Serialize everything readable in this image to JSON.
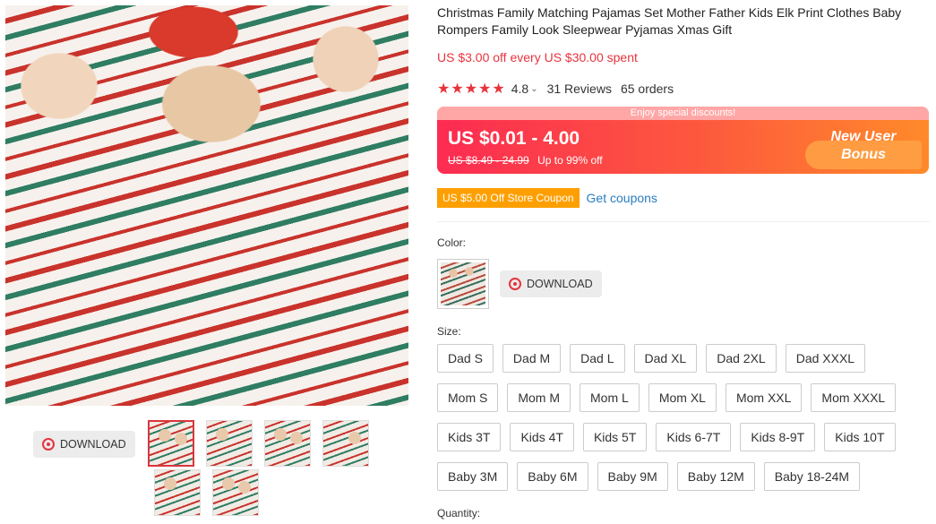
{
  "gallery": {
    "download_label": "DOWNLOAD",
    "thumbnail_count": 6
  },
  "product": {
    "title": "Christmas Family Matching Pajamas Set Mother Father Kids Elk Print Clothes Baby Rompers Family Look Sleepwear Pyjamas Xmas Gift",
    "promo": "US $3.00 off every US $30.00 spent",
    "rating": "4.8",
    "reviews": "31 Reviews",
    "orders": "65 orders"
  },
  "price": {
    "banner": "Enjoy special discounts!",
    "current": "US $0.01 - 4.00",
    "original": "US $8.49 - 24.99",
    "discount": "Up to 99% off",
    "bonus_line1": "New User",
    "bonus_line2": "Bonus"
  },
  "coupon": {
    "tag": "US $5.00 Off Store Coupon",
    "link": "Get coupons"
  },
  "color": {
    "label": "Color:",
    "download_label": "DOWNLOAD"
  },
  "size": {
    "label": "Size:",
    "rows": [
      [
        "Dad S",
        "Dad M",
        "Dad L",
        "Dad XL",
        "Dad 2XL",
        "Dad XXXL"
      ],
      [
        "Mom S",
        "Mom M",
        "Mom L",
        "Mom XL",
        "Mom XXL",
        "Mom XXXL"
      ],
      [
        "Kids 3T",
        "Kids 4T",
        "Kids 5T",
        "Kids 6-7T",
        "Kids 8-9T",
        "Kids 10T"
      ],
      [
        "Baby 3M",
        "Baby 6M",
        "Baby 9M",
        "Baby 12M",
        "Baby 18-24M"
      ]
    ]
  },
  "quantity": {
    "label": "Quantity:"
  },
  "colors": {
    "accent_red": "#e8333d",
    "coupon_orange": "#fe9f00",
    "link_blue": "#2a7dc0"
  }
}
